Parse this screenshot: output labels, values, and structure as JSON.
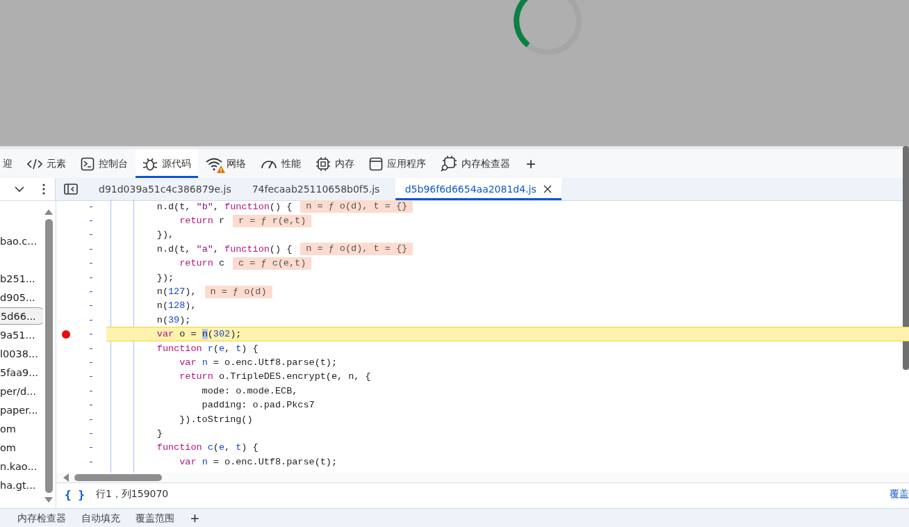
{
  "main_tabs": [
    {
      "label": "迎",
      "selected": false
    },
    {
      "label": "元素",
      "selected": false
    },
    {
      "label": "控制台",
      "selected": false
    },
    {
      "label": "源代码",
      "selected": true
    },
    {
      "label": "网络",
      "selected": false,
      "warning": true
    },
    {
      "label": "性能",
      "selected": false
    },
    {
      "label": "内存",
      "selected": false
    },
    {
      "label": "应用程序",
      "selected": false
    },
    {
      "label": "内存检查器",
      "selected": false
    }
  ],
  "file_tabs": [
    {
      "label": "d91d039a51c4c386879e.js",
      "selected": false
    },
    {
      "label": "74fecaab25110658b0f5.js",
      "selected": false
    },
    {
      "label": "d5b96f6d6654aa2081d4.js",
      "selected": true
    }
  ],
  "sidebar": {
    "items": [
      {
        "label": "bao.c...",
        "selected": false
      },
      {
        "selected": false
      },
      {
        "label": "b251...",
        "selected": false
      },
      {
        "label": "d905...",
        "selected": false
      },
      {
        "label": "5d66...",
        "selected": true
      },
      {
        "label": "9a51...",
        "selected": false
      },
      {
        "label": "l0038...",
        "selected": false
      },
      {
        "label": "5faa9...",
        "selected": false
      },
      {
        "label": "per/d...",
        "selected": false
      },
      {
        "label": "paper...",
        "selected": false
      },
      {
        "label": "om",
        "selected": false
      },
      {
        "label": "om",
        "selected": false
      },
      {
        "label": "n.kao...",
        "selected": false
      },
      {
        "label": "ha.gt...",
        "selected": false
      }
    ]
  },
  "code": [
    {
      "line_number": "-",
      "breakpoint": false,
      "paused": false,
      "tokens": [
        {
          "text": "        n.d(t, ",
          "kind": "plain"
        },
        {
          "text": "\"b\"",
          "kind": "string"
        },
        {
          "text": ", ",
          "kind": "plain"
        },
        {
          "text": "function",
          "kind": "keyword"
        },
        {
          "text": "() {",
          "kind": "plain"
        }
      ],
      "inline_value": "n = ƒ o(d), t = {}"
    },
    {
      "line_number": "-",
      "breakpoint": false,
      "paused": false,
      "tokens": [
        {
          "text": "            return",
          "kind": "keyword"
        },
        {
          "text": " r",
          "kind": "plain"
        }
      ],
      "inline_value": "r = ƒ r(e,t)"
    },
    {
      "line_number": "-",
      "breakpoint": false,
      "paused": false,
      "tokens": [
        {
          "text": "        }),",
          "kind": "plain"
        }
      ]
    },
    {
      "line_number": "-",
      "breakpoint": false,
      "paused": false,
      "tokens": [
        {
          "text": "        n.d(t, ",
          "kind": "plain"
        },
        {
          "text": "\"a\"",
          "kind": "string"
        },
        {
          "text": ", ",
          "kind": "plain"
        },
        {
          "text": "function",
          "kind": "keyword"
        },
        {
          "text": "() {",
          "kind": "plain"
        }
      ],
      "inline_value": "n = ƒ o(d), t = {}"
    },
    {
      "line_number": "-",
      "breakpoint": false,
      "paused": false,
      "tokens": [
        {
          "text": "            return",
          "kind": "keyword"
        },
        {
          "text": " c",
          "kind": "plain"
        }
      ],
      "inline_value": "c = ƒ c(e,t)"
    },
    {
      "line_number": "-",
      "breakpoint": false,
      "paused": false,
      "tokens": [
        {
          "text": "        });",
          "kind": "plain"
        }
      ]
    },
    {
      "line_number": "-",
      "breakpoint": false,
      "paused": false,
      "tokens": [
        {
          "text": "        n(",
          "kind": "plain"
        },
        {
          "text": "127",
          "kind": "number"
        },
        {
          "text": "),",
          "kind": "plain"
        }
      ],
      "inline_value": "n = ƒ o(d)"
    },
    {
      "line_number": "-",
      "breakpoint": false,
      "paused": false,
      "tokens": [
        {
          "text": "        n(",
          "kind": "plain"
        },
        {
          "text": "128",
          "kind": "number"
        },
        {
          "text": "),",
          "kind": "plain"
        }
      ]
    },
    {
      "line_number": "-",
      "breakpoint": false,
      "paused": false,
      "tokens": [
        {
          "text": "        n(",
          "kind": "plain"
        },
        {
          "text": "39",
          "kind": "number"
        },
        {
          "text": ");",
          "kind": "plain"
        }
      ]
    },
    {
      "line_number": "-",
      "breakpoint": true,
      "paused": true,
      "tokens": [
        {
          "text": "        var",
          "kind": "keyword"
        },
        {
          "text": " o = ",
          "kind": "plain"
        },
        {
          "text": "n",
          "kind": "selection"
        },
        {
          "text": "(",
          "kind": "plain"
        },
        {
          "text": "302",
          "kind": "number"
        },
        {
          "text": ");",
          "kind": "plain"
        }
      ]
    },
    {
      "line_number": "-",
      "breakpoint": false,
      "paused": false,
      "tokens": [
        {
          "text": "        function",
          "kind": "keyword"
        },
        {
          "text": " r",
          "kind": "name"
        },
        {
          "text": "(",
          "kind": "plain"
        },
        {
          "text": "e",
          "kind": "name"
        },
        {
          "text": ", ",
          "kind": "plain"
        },
        {
          "text": "t",
          "kind": "name"
        },
        {
          "text": ") {",
          "kind": "plain"
        }
      ]
    },
    {
      "line_number": "-",
      "breakpoint": false,
      "paused": false,
      "tokens": [
        {
          "text": "            var",
          "kind": "keyword"
        },
        {
          "text": " n",
          "kind": "name"
        },
        {
          "text": " = o.enc.Utf8.parse(t);",
          "kind": "plain"
        }
      ]
    },
    {
      "line_number": "-",
      "breakpoint": false,
      "paused": false,
      "tokens": [
        {
          "text": "            return",
          "kind": "keyword"
        },
        {
          "text": " o.TripleDES.encrypt(e, n, {",
          "kind": "plain"
        }
      ]
    },
    {
      "line_number": "-",
      "breakpoint": false,
      "paused": false,
      "tokens": [
        {
          "text": "                mode: o.mode.ECB,",
          "kind": "plain"
        }
      ]
    },
    {
      "line_number": "-",
      "breakpoint": false,
      "paused": false,
      "tokens": [
        {
          "text": "                padding: o.pad.Pkcs7",
          "kind": "plain"
        }
      ]
    },
    {
      "line_number": "-",
      "breakpoint": false,
      "paused": false,
      "tokens": [
        {
          "text": "            }).toString()",
          "kind": "plain"
        }
      ]
    },
    {
      "line_number": "-",
      "breakpoint": false,
      "paused": false,
      "tokens": [
        {
          "text": "        }",
          "kind": "plain"
        }
      ]
    },
    {
      "line_number": "-",
      "breakpoint": false,
      "paused": false,
      "tokens": [
        {
          "text": "        function",
          "kind": "keyword"
        },
        {
          "text": " c",
          "kind": "name"
        },
        {
          "text": "(",
          "kind": "plain"
        },
        {
          "text": "e",
          "kind": "name"
        },
        {
          "text": ", ",
          "kind": "plain"
        },
        {
          "text": "t",
          "kind": "name"
        },
        {
          "text": ") {",
          "kind": "plain"
        }
      ]
    },
    {
      "line_number": "-",
      "breakpoint": false,
      "paused": false,
      "tokens": [
        {
          "text": "            var",
          "kind": "keyword"
        },
        {
          "text": " n",
          "kind": "name"
        },
        {
          "text": " = o.enc.Utf8.parse(t);",
          "kind": "plain"
        }
      ]
    }
  ],
  "status_bar": {
    "format_button": "{ }",
    "position": "行1，列159070",
    "right_link": "覆盖"
  },
  "drawer_tabs": [
    {
      "label": "内存检查器",
      "selected": false
    },
    {
      "label": "自动填充",
      "selected": false
    },
    {
      "label": "覆盖范围",
      "selected": false
    }
  ],
  "add_tab": "+"
}
